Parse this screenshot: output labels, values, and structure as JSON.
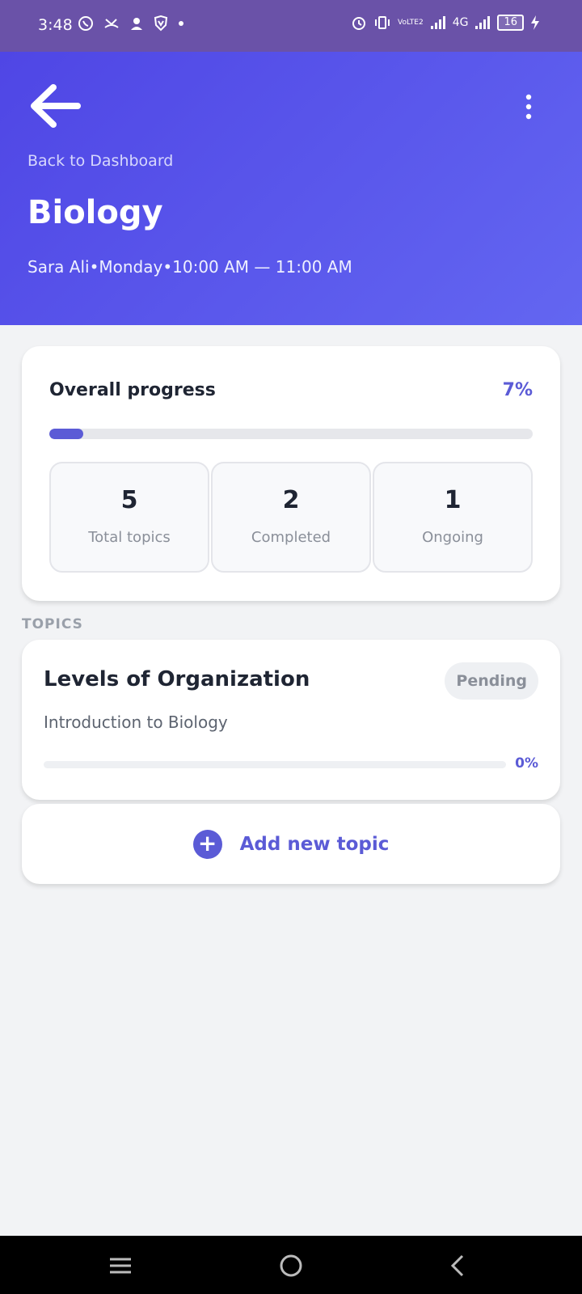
{
  "status_bar": {
    "time": "3:48",
    "battery": "16",
    "network": "4G",
    "volte": "VoLTE2"
  },
  "header": {
    "back_link": "Back to Dashboard",
    "title": "Biology",
    "meta": "Sara Ali•Monday•10:00 AM — 11:00 AM"
  },
  "progress": {
    "label": "Overall progress",
    "percent_text": "7%",
    "percent_value": 7,
    "stats": [
      {
        "value": "5",
        "label": "Total topics"
      },
      {
        "value": "2",
        "label": "Completed"
      },
      {
        "value": "1",
        "label": "Ongoing"
      }
    ]
  },
  "topics_section": {
    "title": "TOPICS",
    "items": [
      {
        "name": "Levels of Organization",
        "status": "Pending",
        "subtitle": "Introduction to Biology",
        "percent_text": "0%",
        "percent_value": 0
      }
    ]
  },
  "add_topic": {
    "label": "Add new topic"
  },
  "colors": {
    "accent": "#5b5bd6",
    "header_start": "#4f46e5",
    "header_end": "#6366f1",
    "status_bar": "#6a52a8"
  }
}
